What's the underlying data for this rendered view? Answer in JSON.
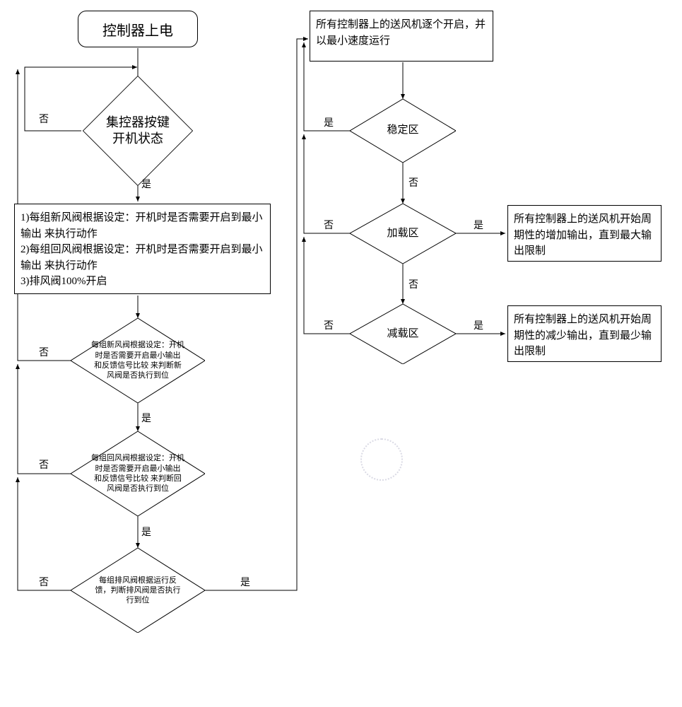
{
  "nodes": {
    "power_on": "控制器上电",
    "key_status": "集控器按键\n开机状态",
    "valve_settings": "1)每组新风阀根据设定：开机时是否需要开启到最小输出 来执行动作\n2)每组回风阀根据设定：开机时是否需要开启到最小输出 来执行动作\n3)排风阀100%开启",
    "fresh_valve_check": "每组新风阀根据设定：开机时是否需要开启最小输出 和反馈信号比较 来判断新风阀是否执行到位",
    "return_valve_check": "每组回风阀根据设定：开机时是否需要开启最小输出 和反馈信号比较 来判断回风阀是否执行到位",
    "exhaust_valve_check": "每组排风阀根据运行反馈，判断排风阀是否执行行到位",
    "fan_start": "所有控制器上的送风机逐个开启，并以最小速度运行",
    "stable_zone": "稳定区",
    "load_zone": "加载区",
    "unload_zone": "减载区",
    "increase_output": "所有控制器上的送风机开始周期性的增加输出，直到最大输出限制",
    "decrease_output": "所有控制器上的送风机开始周期性的减少输出，直到最少输出限制"
  },
  "labels": {
    "yes": "是",
    "no": "否"
  }
}
